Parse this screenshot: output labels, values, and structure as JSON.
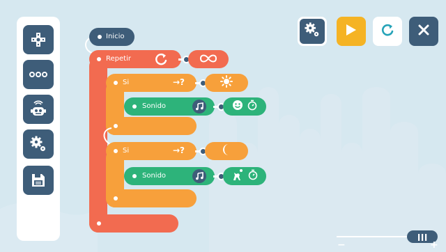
{
  "sidebar": {
    "items": [
      {
        "name": "dpad",
        "icon": "dpad-icon"
      },
      {
        "name": "more",
        "icon": "more-icon"
      },
      {
        "name": "robot",
        "icon": "robot-icon"
      },
      {
        "name": "settings",
        "icon": "settings-icon"
      },
      {
        "name": "save",
        "icon": "save-icon"
      }
    ]
  },
  "toolbar": {
    "buttons": [
      {
        "name": "program-settings",
        "icon": "gears-icon"
      },
      {
        "name": "play",
        "icon": "play-icon"
      },
      {
        "name": "reload",
        "icon": "reload-icon"
      },
      {
        "name": "close",
        "icon": "close-icon"
      }
    ]
  },
  "blocks": {
    "start_label": "Inicio",
    "repeat_label": "Repetir",
    "repeat_param": "infinity-icon",
    "if1_label": "Si",
    "if1_arrow": "→?",
    "if1_param": "sun-icon",
    "sound1_label": "Sonido",
    "sound1_icon": "music-note-icon",
    "sound1_param": "face-timer-icon",
    "if2_label": "Si",
    "if2_arrow": "→?",
    "if2_param": "moon-icon",
    "sound2_label": "Sonido",
    "sound2_icon": "music-note-icon",
    "sound2_param": "wolf-timer-icon"
  },
  "zoom": {
    "minus": "−",
    "plus": "+",
    "level": 1.0
  },
  "colors": {
    "background": "#d6e8f0",
    "dark_blue": "#3e5d79",
    "repeat_red": "#f26b50",
    "if_orange": "#f7a03b",
    "sound_green": "#2db37a",
    "play_yellow": "#f5b324",
    "reload_teal": "#25a3b8"
  }
}
